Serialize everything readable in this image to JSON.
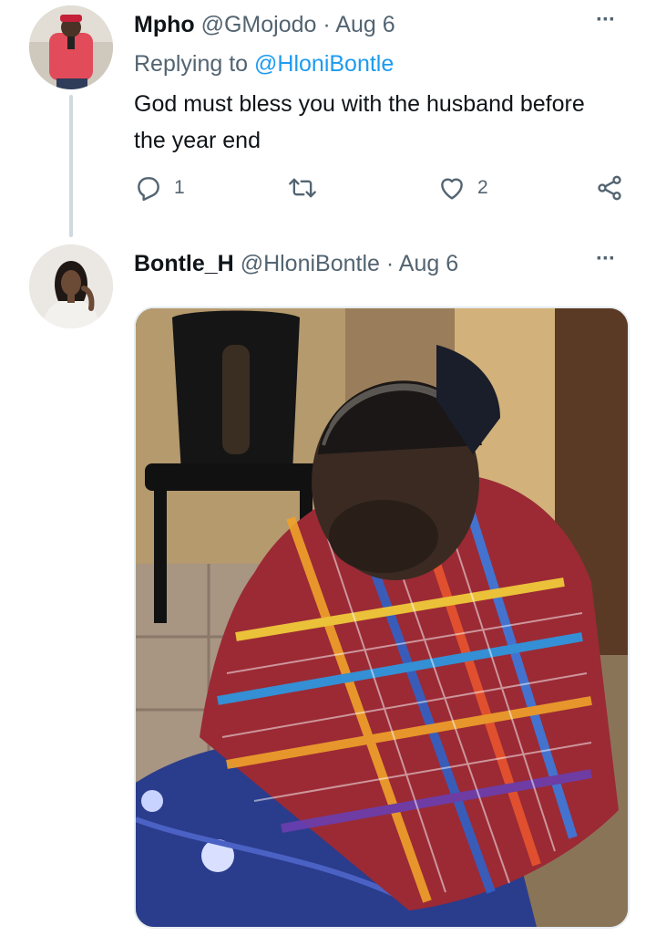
{
  "tweets": [
    {
      "display_name": "Mpho",
      "handle": "@GMojodo",
      "separator": "·",
      "date": "Aug 6",
      "replying_prefix": "Replying to",
      "replying_to": "@HloniBontle",
      "text": "God must bless you with the husband before the year end",
      "reply_count": "1",
      "like_count": "2",
      "more_label": "···"
    },
    {
      "display_name": "Bontle_H",
      "handle": "@HloniBontle",
      "separator": "·",
      "date": "Aug 6",
      "more_label": "···"
    }
  ],
  "icons": {
    "reply": "reply-icon",
    "retweet": "retweet-icon",
    "like": "heart-icon",
    "share": "share-icon"
  },
  "colors": {
    "link": "#1d9bf0",
    "secondary_text": "#536471",
    "thread_line": "#cfd9de"
  }
}
